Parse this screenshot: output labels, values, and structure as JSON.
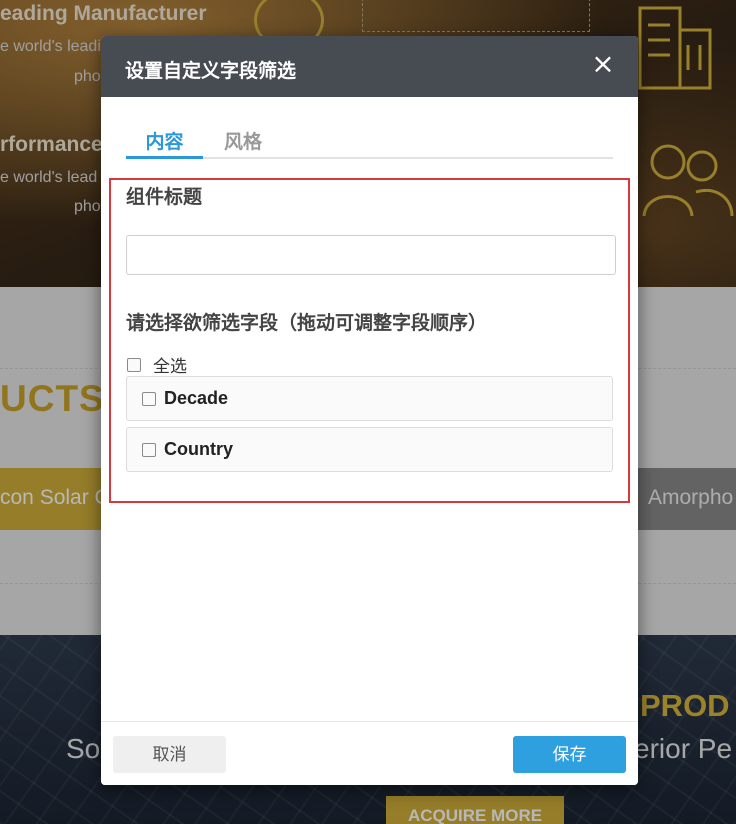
{
  "background": {
    "hero": {
      "headline_1": "eading Manufacturer",
      "line_1": "e world's leadi",
      "line_2": "pho",
      "headline_2": "rformance",
      "line_3": "e world's lead",
      "line_4": "pho"
    },
    "products_heading": "UCTS",
    "category_left": "con Solar C",
    "category_right": "Amorpho",
    "products_heading_2": "PROD",
    "tagline_left": "So",
    "tagline_right": "erior Pe",
    "acquire_button": "ACQUIRE MORE"
  },
  "modal": {
    "title": "设置自定义字段筛选",
    "close_icon": "close-icon",
    "tabs": [
      {
        "label": "内容",
        "active": true
      },
      {
        "label": "风格",
        "active": false
      }
    ],
    "component_title_label": "组件标题",
    "component_title_value": "",
    "fields_label": "请选择欲筛选字段（拖动可调整字段顺序）",
    "select_all_label": "全选",
    "fields": [
      {
        "label": "Decade",
        "checked": false
      },
      {
        "label": "Country",
        "checked": false
      }
    ],
    "cancel_label": "取消",
    "save_label": "保存"
  },
  "colors": {
    "accent": "#2ea0e0",
    "tab_active": "#2b98d7",
    "header_bg": "#474b52",
    "highlight_border": "#d9393c",
    "brand_gold": "#cfae3a"
  }
}
